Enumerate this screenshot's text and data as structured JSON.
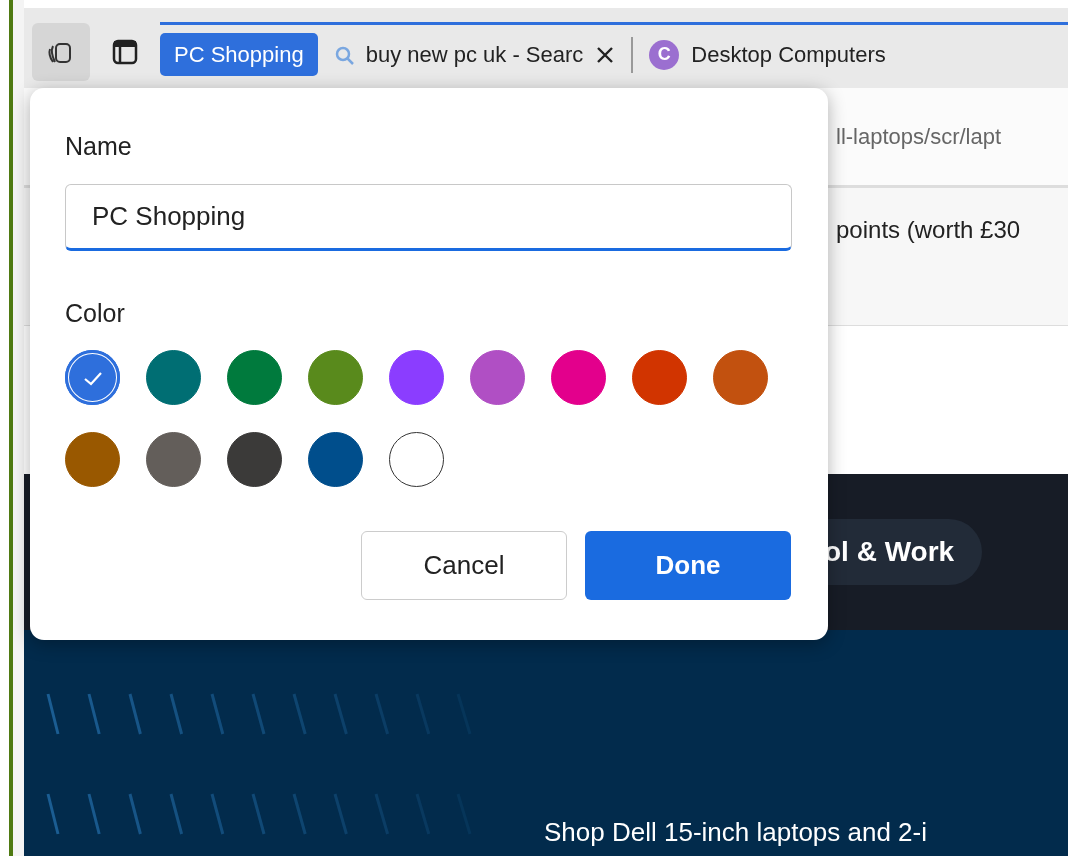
{
  "tab_strip": {
    "group": {
      "label": "PC Shopping",
      "color": "#2e6fdc"
    },
    "tabs": [
      {
        "title": "buy new pc uk - Searc",
        "kind": "search",
        "close_button": true
      },
      {
        "title": "Desktop Computers",
        "kind": "letter",
        "favicon_text": "C",
        "close_button": false
      }
    ]
  },
  "page": {
    "address_text": "ll-laptops/scr/lapt",
    "banner_text": "points (worth £30",
    "category_pill": "ol & Work",
    "hero_text": "Shop Dell 15-inch laptops and 2-i"
  },
  "dialog": {
    "name_label": "Name",
    "name_value": "PC Shopping",
    "color_label": "Color",
    "colors": [
      {
        "color": "#2e6fdc",
        "selected": true
      },
      {
        "color": "#006e73",
        "selected": false
      },
      {
        "color": "#007a3d",
        "selected": false
      },
      {
        "color": "#598a1c",
        "selected": false
      },
      {
        "color": "#8b3dff",
        "selected": false
      },
      {
        "color": "#b04fc4",
        "selected": false
      },
      {
        "color": "#e3008c",
        "selected": false
      },
      {
        "color": "#d13400",
        "selected": false
      },
      {
        "color": "#c2510f",
        "selected": false
      },
      {
        "color": "#995800",
        "selected": false
      },
      {
        "color": "#635e5a",
        "selected": false
      },
      {
        "color": "#3b3a39",
        "selected": false
      },
      {
        "color": "#004e8c",
        "selected": false
      },
      {
        "color": "#ffffff",
        "selected": false
      }
    ],
    "buttons": [
      {
        "label": "Cancel",
        "kind": "secondary"
      },
      {
        "label": "Done",
        "kind": "primary"
      }
    ]
  }
}
